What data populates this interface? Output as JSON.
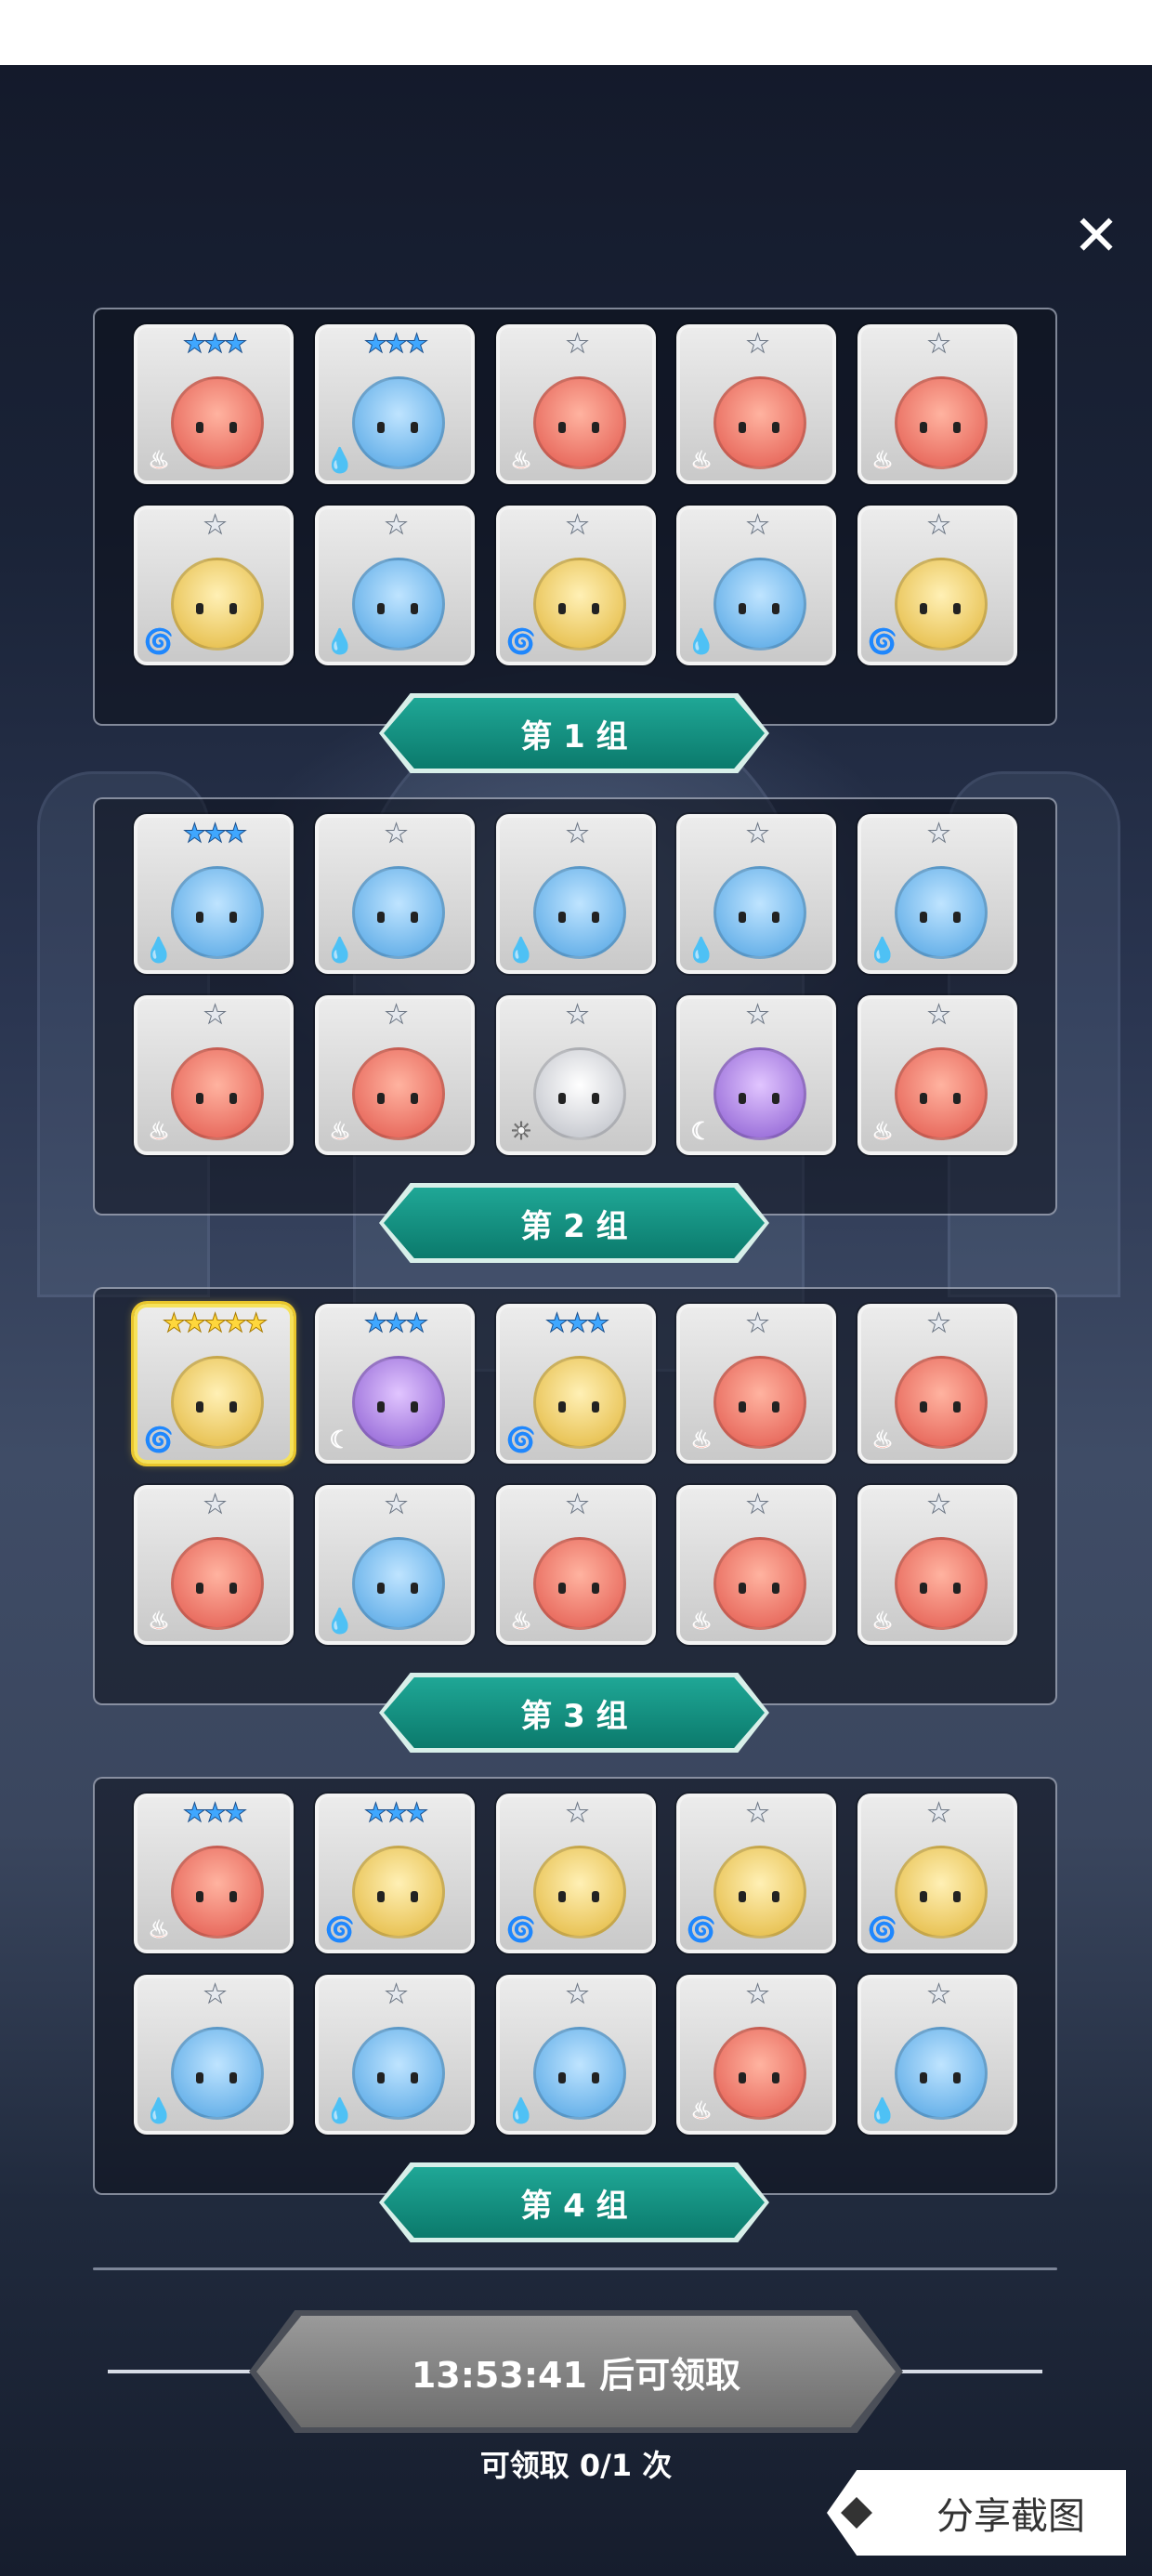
{
  "close_icon": "✕",
  "groups": [
    {
      "label": "第 1 组",
      "heroes": [
        {
          "stars": 3,
          "element": "fire"
        },
        {
          "stars": 3,
          "element": "water"
        },
        {
          "stars": 1,
          "element": "fire"
        },
        {
          "stars": 1,
          "element": "fire"
        },
        {
          "stars": 1,
          "element": "fire"
        },
        {
          "stars": 1,
          "element": "wind"
        },
        {
          "stars": 1,
          "element": "water"
        },
        {
          "stars": 1,
          "element": "wind"
        },
        {
          "stars": 1,
          "element": "water"
        },
        {
          "stars": 1,
          "element": "wind"
        }
      ]
    },
    {
      "label": "第 2 组",
      "heroes": [
        {
          "stars": 3,
          "element": "water"
        },
        {
          "stars": 1,
          "element": "water"
        },
        {
          "stars": 1,
          "element": "water"
        },
        {
          "stars": 1,
          "element": "water"
        },
        {
          "stars": 1,
          "element": "water"
        },
        {
          "stars": 1,
          "element": "fire"
        },
        {
          "stars": 1,
          "element": "fire"
        },
        {
          "stars": 1,
          "element": "light"
        },
        {
          "stars": 1,
          "element": "dark"
        },
        {
          "stars": 1,
          "element": "fire"
        }
      ]
    },
    {
      "label": "第 3 组",
      "heroes": [
        {
          "stars": 5,
          "element": "wind",
          "highlight": true
        },
        {
          "stars": 3,
          "element": "dark"
        },
        {
          "stars": 3,
          "element": "wind"
        },
        {
          "stars": 1,
          "element": "fire"
        },
        {
          "stars": 1,
          "element": "fire"
        },
        {
          "stars": 1,
          "element": "fire"
        },
        {
          "stars": 1,
          "element": "water"
        },
        {
          "stars": 1,
          "element": "fire"
        },
        {
          "stars": 1,
          "element": "fire"
        },
        {
          "stars": 1,
          "element": "fire"
        }
      ]
    },
    {
      "label": "第 4 组",
      "heroes": [
        {
          "stars": 3,
          "element": "fire"
        },
        {
          "stars": 3,
          "element": "wind"
        },
        {
          "stars": 1,
          "element": "wind"
        },
        {
          "stars": 1,
          "element": "wind"
        },
        {
          "stars": 1,
          "element": "wind"
        },
        {
          "stars": 1,
          "element": "water"
        },
        {
          "stars": 1,
          "element": "water"
        },
        {
          "stars": 1,
          "element": "water"
        },
        {
          "stars": 1,
          "element": "fire"
        },
        {
          "stars": 1,
          "element": "water"
        }
      ]
    }
  ],
  "element_icons": {
    "fire": "♨",
    "water": "💧",
    "wind": "🌀",
    "light": "☀",
    "dark": "☾"
  },
  "claim": {
    "label": "13:53:41 后可领取",
    "count_text": "可领取 0/1 次"
  },
  "share": {
    "label": "分享截图"
  }
}
